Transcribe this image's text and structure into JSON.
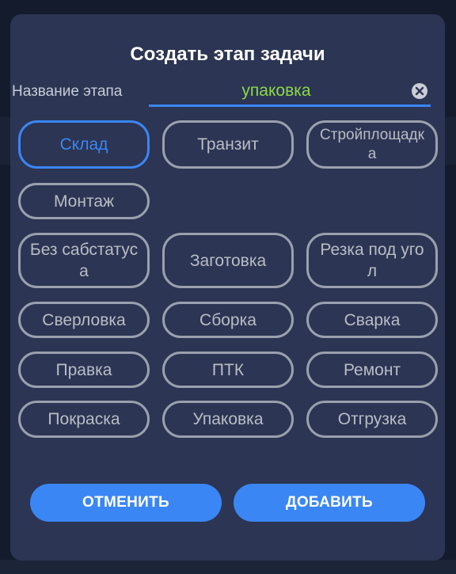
{
  "dialog": {
    "title": "Создать этап задачи",
    "field_label": "Название этапа",
    "field_value": "упаковка",
    "clear_icon": "close-circle-icon",
    "accent_color": "#3a86f5",
    "value_color": "#8bd94a"
  },
  "stages": [
    {
      "label": "Склад",
      "selected": true
    },
    {
      "label": "Транзит",
      "selected": false
    },
    {
      "label": "Стройплощадка",
      "selected": false
    },
    {
      "label": "Монтаж",
      "selected": false
    },
    {
      "label": "Без сабстатуса",
      "selected": false
    },
    {
      "label": "Заготовка",
      "selected": false
    },
    {
      "label": "Резка под угол",
      "selected": false
    },
    {
      "label": "Сверловка",
      "selected": false
    },
    {
      "label": "Сборка",
      "selected": false
    },
    {
      "label": "Сварка",
      "selected": false
    },
    {
      "label": "Правка",
      "selected": false
    },
    {
      "label": "ПТК",
      "selected": false
    },
    {
      "label": "Ремонт",
      "selected": false
    },
    {
      "label": "Покраска",
      "selected": false
    },
    {
      "label": "Упаковка",
      "selected": false
    },
    {
      "label": "Отгрузка",
      "selected": false
    }
  ],
  "actions": {
    "cancel_label": "ОТМЕНИТЬ",
    "add_label": "ДОБАВИТЬ"
  }
}
